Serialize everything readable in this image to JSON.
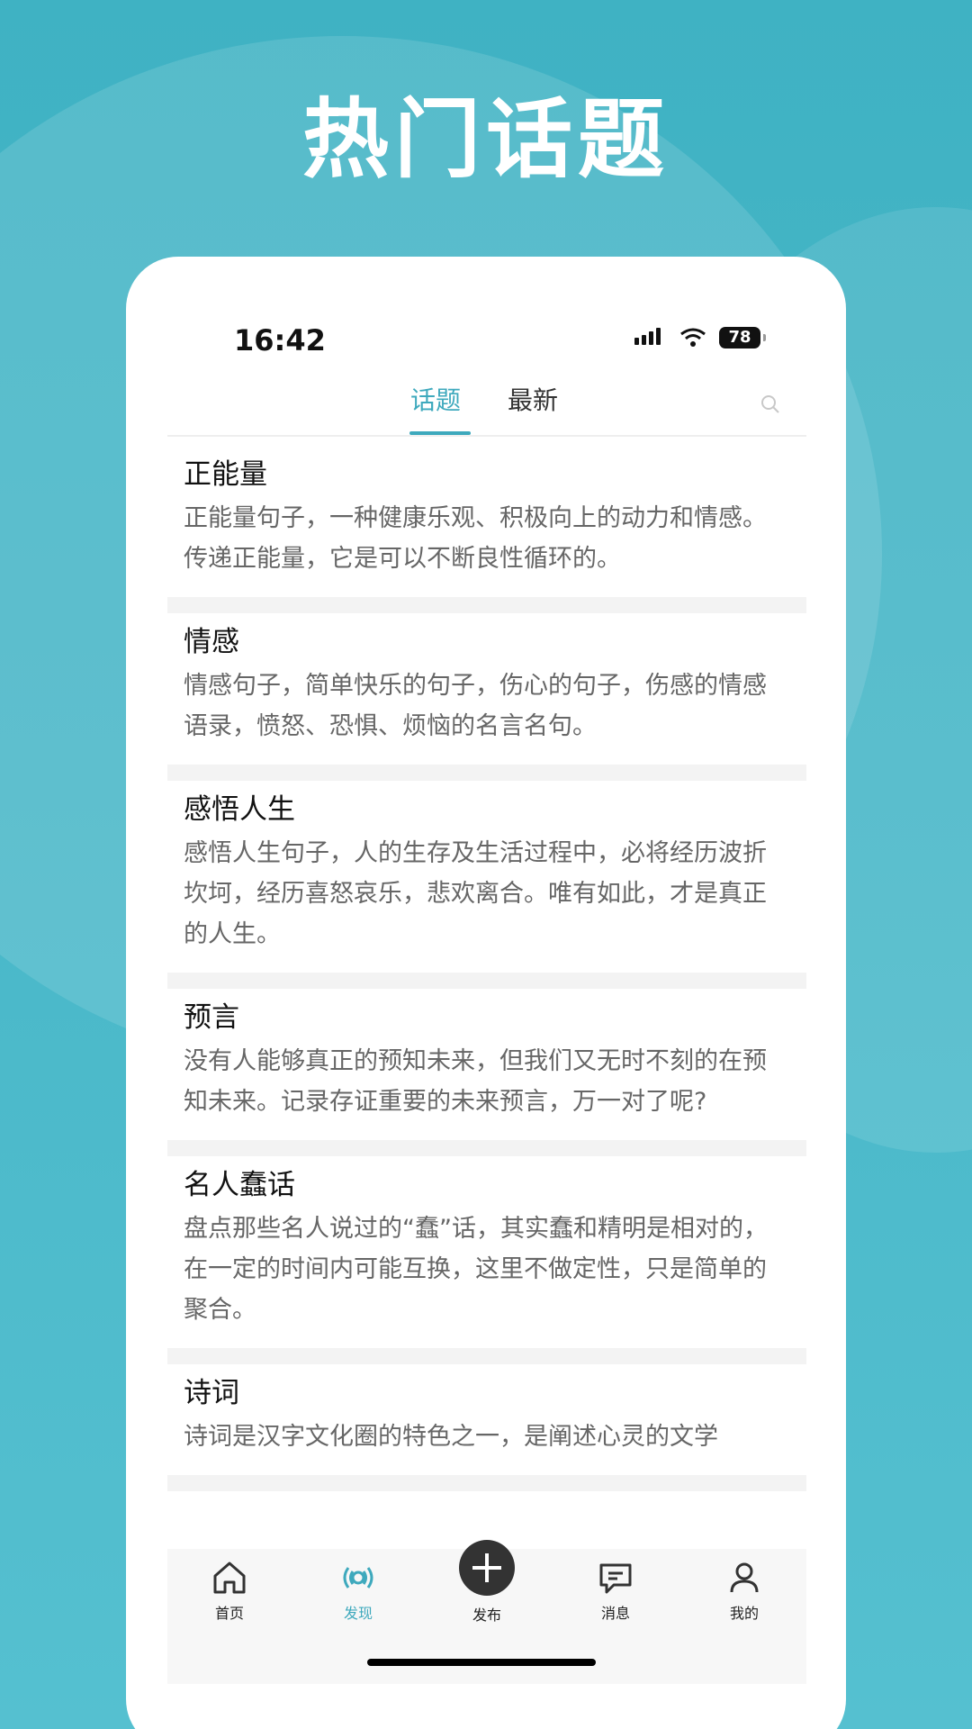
{
  "hero": {
    "title": "热门话题"
  },
  "status": {
    "time": "16:42",
    "battery": "78"
  },
  "tabs": {
    "topic": "话题",
    "latest": "最新"
  },
  "topics": [
    {
      "title": "正能量",
      "desc": "正能量句子，一种健康乐观、积极向上的动力和情感。传递正能量，它是可以不断良性循环的。"
    },
    {
      "title": "情感",
      "desc": "情感句子，简单快乐的句子，伤心的句子，伤感的情感语录，愤怒、恐惧、烦恼的名言名句。"
    },
    {
      "title": "感悟人生",
      "desc": "感悟人生句子，人的生存及生活过程中，必将经历波折坎坷，经历喜怒哀乐，悲欢离合。唯有如此，才是真正的人生。"
    },
    {
      "title": "预言",
      "desc": "没有人能够真正的预知未来，但我们又无时不刻的在预知未来。记录存证重要的未来预言，万一对了呢?"
    },
    {
      "title": "名人蠢话",
      "desc": "盘点那些名人说过的“蠢”话，其实蠢和精明是相对的，在一定的时间内可能互换，这里不做定性，只是简单的聚合。"
    },
    {
      "title": "诗词",
      "desc": "诗词是汉字文化圈的特色之一，是阐述心灵的文学"
    }
  ],
  "nav": {
    "home": "首页",
    "discover": "发现",
    "publish": "发布",
    "messages": "消息",
    "mine": "我的"
  },
  "colors": {
    "accent": "#3ea9bd",
    "background": "#41b2c4"
  }
}
